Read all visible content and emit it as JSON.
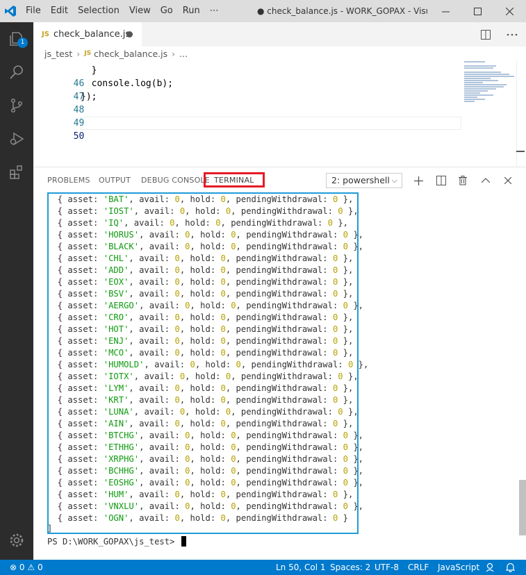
{
  "titlebar": {
    "menu": [
      "File",
      "Edit",
      "Selection",
      "View",
      "Go",
      "Run",
      "⋯"
    ],
    "window_title": "● check_balance.js - WORK_GOPAX - Visual S..."
  },
  "activity": {
    "badge": "1"
  },
  "tab": {
    "js": "JS",
    "label": "check_balance.js"
  },
  "breadcrumb": {
    "folder": "js_test",
    "js": "JS",
    "file": "check_balance.js",
    "more": "..."
  },
  "editor": {
    "lines": [
      {
        "num": "46",
        "code": "  }"
      },
      {
        "num": "47",
        "code": "  console.log(b);"
      },
      {
        "num": "48",
        "code": "});"
      },
      {
        "num": "49",
        "code": ""
      },
      {
        "num": "50",
        "code": ""
      }
    ]
  },
  "panel": {
    "tabs": [
      "PROBLEMS",
      "OUTPUT",
      "DEBUG CONSOLE",
      "TERMINAL"
    ],
    "shell": "2: powershell"
  },
  "terminal": {
    "rows": [
      {
        "asset": "BAT",
        "avail": "0",
        "hold": "0",
        "pw": "0",
        "end": "},"
      },
      {
        "asset": "IOST",
        "avail": "0",
        "hold": "0",
        "pw": "0",
        "end": "},"
      },
      {
        "asset": "IQ",
        "avail": "0",
        "hold": "0",
        "pw": "0",
        "end": "},"
      },
      {
        "asset": "HORUS",
        "avail": "0",
        "hold": "0",
        "pw": "0",
        "end": "},"
      },
      {
        "asset": "BLACK",
        "avail": "0",
        "hold": "0",
        "pw": "0",
        "end": "},"
      },
      {
        "asset": "CHL",
        "avail": "0",
        "hold": "0",
        "pw": "0",
        "end": "},"
      },
      {
        "asset": "ADD",
        "avail": "0",
        "hold": "0",
        "pw": "0",
        "end": "},"
      },
      {
        "asset": "EOX",
        "avail": "0",
        "hold": "0",
        "pw": "0",
        "end": "},"
      },
      {
        "asset": "BSV",
        "avail": "0",
        "hold": "0",
        "pw": "0",
        "end": "},"
      },
      {
        "asset": "AERGO",
        "avail": "0",
        "hold": "0",
        "pw": "0",
        "end": "},"
      },
      {
        "asset": "CRO",
        "avail": "0",
        "hold": "0",
        "pw": "0",
        "end": "},"
      },
      {
        "asset": "HOT",
        "avail": "0",
        "hold": "0",
        "pw": "0",
        "end": "},"
      },
      {
        "asset": "ENJ",
        "avail": "0",
        "hold": "0",
        "pw": "0",
        "end": "},"
      },
      {
        "asset": "MCO",
        "avail": "0",
        "hold": "0",
        "pw": "0",
        "end": "},"
      },
      {
        "asset": "HUMOLD",
        "avail": "0",
        "hold": "0",
        "pw": "0",
        "end": "},"
      },
      {
        "asset": "IOTX",
        "avail": "0",
        "hold": "0",
        "pw": "0",
        "end": "},"
      },
      {
        "asset": "LYM",
        "avail": "0",
        "hold": "0",
        "pw": "0",
        "end": "},"
      },
      {
        "asset": "KRT",
        "avail": "0",
        "hold": "0",
        "pw": "0",
        "end": "},"
      },
      {
        "asset": "LUNA",
        "avail": "0",
        "hold": "0",
        "pw": "0",
        "end": "},"
      },
      {
        "asset": "AIN",
        "avail": "0",
        "hold": "0",
        "pw": "0",
        "end": "},"
      },
      {
        "asset": "BTCHG",
        "avail": "0",
        "hold": "0",
        "pw": "0",
        "end": "},"
      },
      {
        "asset": "ETHHG",
        "avail": "0",
        "hold": "0",
        "pw": "0",
        "end": "},"
      },
      {
        "asset": "XRPHG",
        "avail": "0",
        "hold": "0",
        "pw": "0",
        "end": "},"
      },
      {
        "asset": "BCHHG",
        "avail": "0",
        "hold": "0",
        "pw": "0",
        "end": "},"
      },
      {
        "asset": "EOSHG",
        "avail": "0",
        "hold": "0",
        "pw": "0",
        "end": "},"
      },
      {
        "asset": "HUM",
        "avail": "0",
        "hold": "0",
        "pw": "0",
        "end": "},"
      },
      {
        "asset": "VNXLU",
        "avail": "0",
        "hold": "0",
        "pw": "0",
        "end": "},"
      },
      {
        "asset": "OGN",
        "avail": "0",
        "hold": "0",
        "pw": "0",
        "end": "}"
      }
    ],
    "closing": "]",
    "prompt": "PS D:\\WORK_GOPAX\\js_test> "
  },
  "status": {
    "errors": "0",
    "warnings": "0",
    "position": "Ln 50, Col 1",
    "spaces": "Spaces: 2",
    "encoding": "UTF-8",
    "eol": "CRLF",
    "language": "JavaScript"
  },
  "colors": {
    "accent": "#007acc",
    "highlight_red": "#e51b24",
    "highlight_blue": "#1e9bd7",
    "string_green": "#0f9a0f",
    "number_yellow": "#b7a100"
  }
}
